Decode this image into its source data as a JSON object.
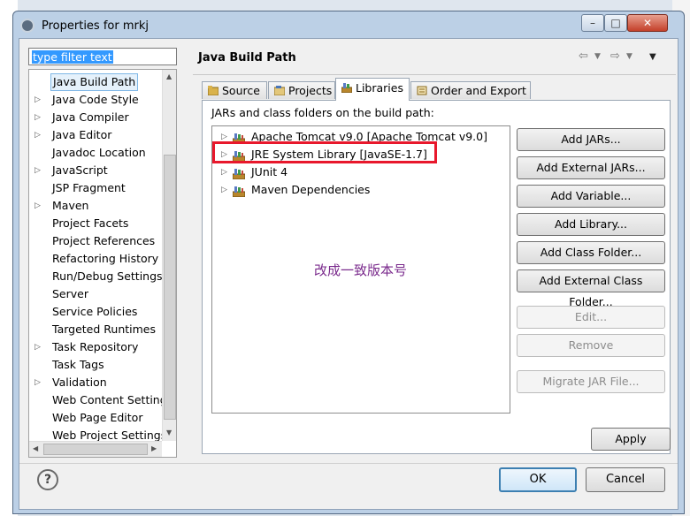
{
  "window": {
    "title": "Properties for mrkj",
    "minimize": "–",
    "maximize": "□",
    "close": "✕"
  },
  "filter": {
    "value": "type filter text"
  },
  "tree": {
    "items": [
      {
        "label": "Java Build Path",
        "expandable": false,
        "selected": true
      },
      {
        "label": "Java Code Style",
        "expandable": true
      },
      {
        "label": "Java Compiler",
        "expandable": true
      },
      {
        "label": "Java Editor",
        "expandable": true
      },
      {
        "label": "Javadoc Location",
        "expandable": false
      },
      {
        "label": "JavaScript",
        "expandable": true
      },
      {
        "label": "JSP Fragment",
        "expandable": false
      },
      {
        "label": "Maven",
        "expandable": true
      },
      {
        "label": "Project Facets",
        "expandable": false
      },
      {
        "label": "Project References",
        "expandable": false
      },
      {
        "label": "Refactoring History",
        "expandable": false
      },
      {
        "label": "Run/Debug Settings",
        "expandable": false
      },
      {
        "label": "Server",
        "expandable": false
      },
      {
        "label": "Service Policies",
        "expandable": false
      },
      {
        "label": "Targeted Runtimes",
        "expandable": false
      },
      {
        "label": "Task Repository",
        "expandable": true
      },
      {
        "label": "Task Tags",
        "expandable": false
      },
      {
        "label": "Validation",
        "expandable": true
      },
      {
        "label": "Web Content Settings",
        "expandable": false
      },
      {
        "label": "Web Page Editor",
        "expandable": false
      },
      {
        "label": "Web Project Settings",
        "expandable": false
      }
    ]
  },
  "page": {
    "title": "Java Build Path"
  },
  "tabs": [
    {
      "label": "Source"
    },
    {
      "label": "Projects"
    },
    {
      "label": "Libraries"
    },
    {
      "label": "Order and Export"
    }
  ],
  "libraries": {
    "caption": "JARs and class folders on the build path:",
    "items": [
      {
        "label": "Apache Tomcat v9.0 [Apache Tomcat v9.0]"
      },
      {
        "label": "JRE System Library [JavaSE-1.7]"
      },
      {
        "label": "JUnit 4"
      },
      {
        "label": "Maven Dependencies"
      }
    ],
    "annotation": "改成一致版本号",
    "highlight_color": "#e8182c"
  },
  "buttons": {
    "add_jars": "Add JARs...",
    "add_external_jars": "Add External JARs...",
    "add_variable": "Add Variable...",
    "add_library": "Add Library...",
    "add_class_folder": "Add Class Folder...",
    "add_external_class_folder": "Add External Class Folder...",
    "edit": "Edit...",
    "remove": "Remove",
    "migrate_jar": "Migrate JAR File...",
    "apply": "Apply",
    "ok": "OK",
    "cancel": "Cancel",
    "help": "?"
  }
}
